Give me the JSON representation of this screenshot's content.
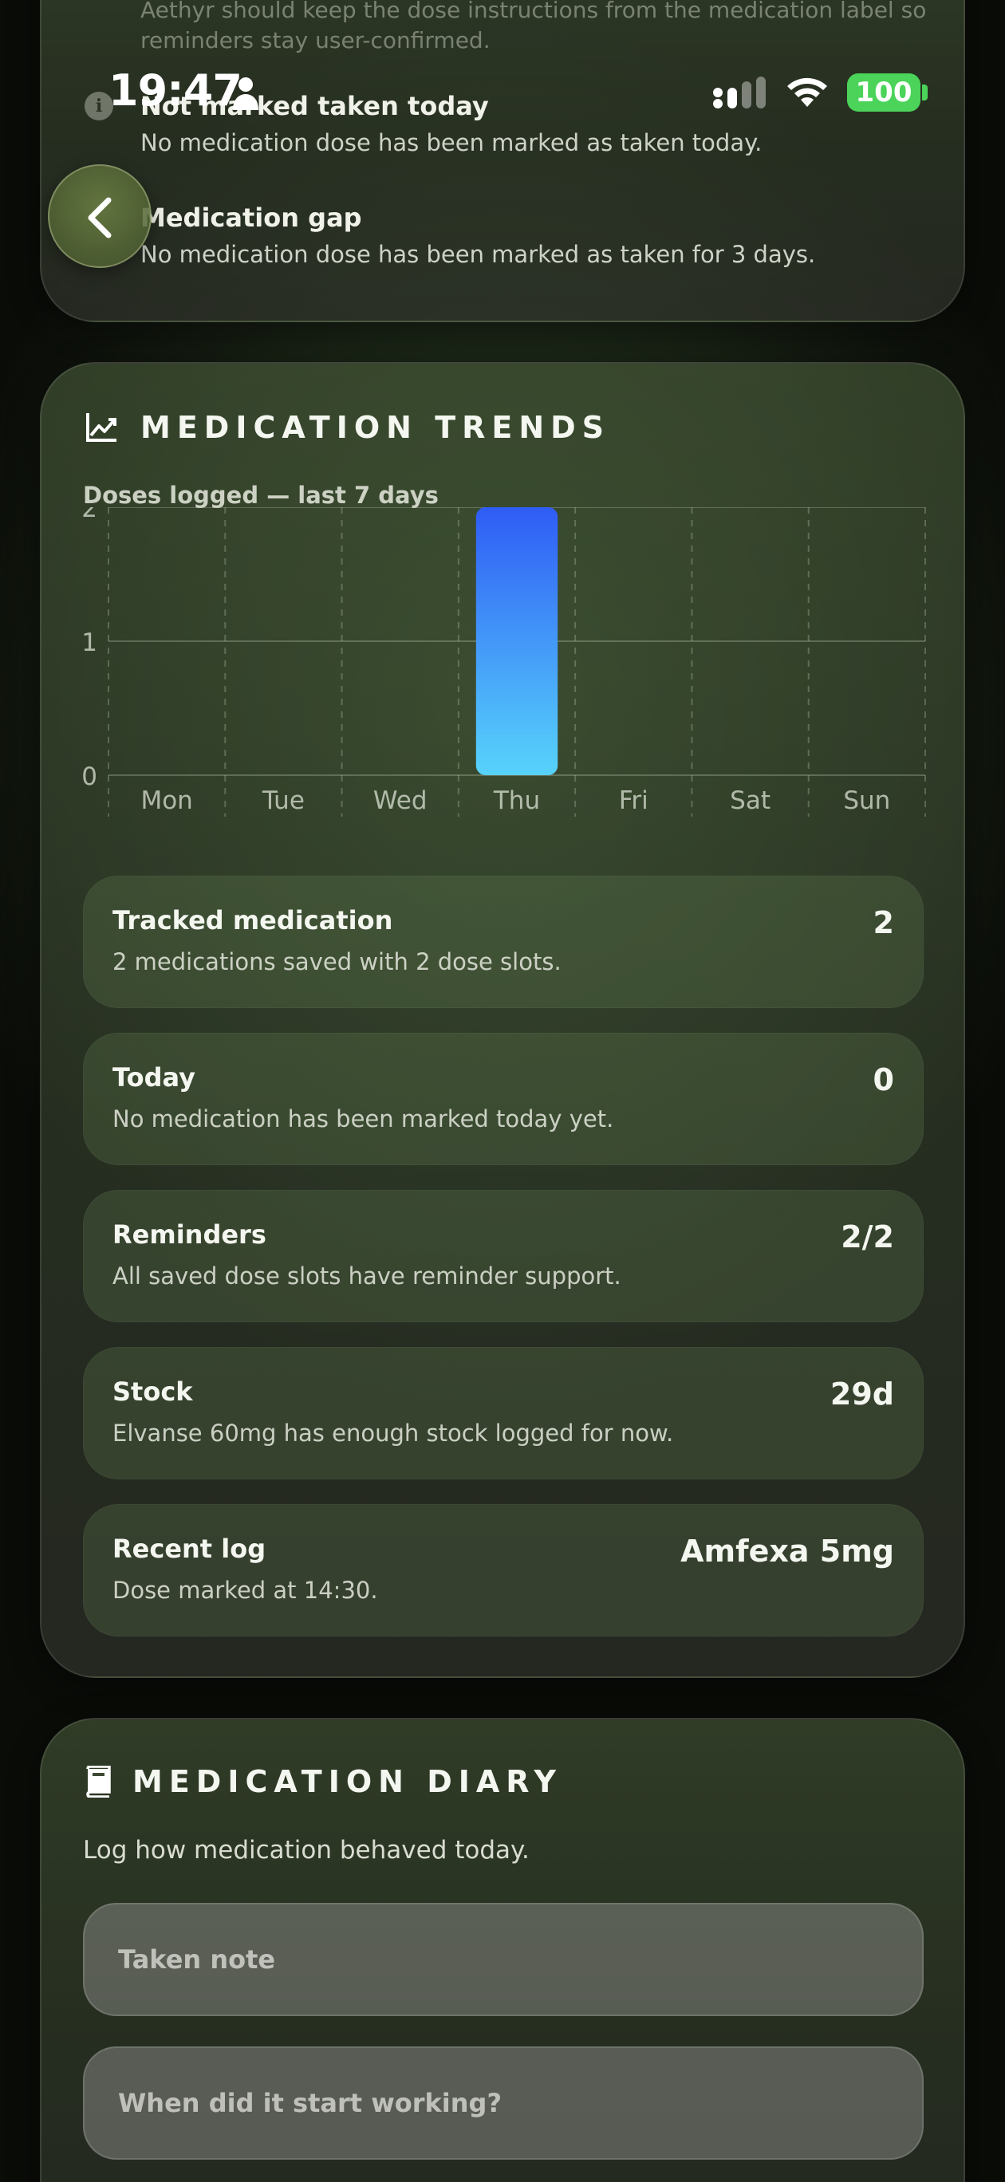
{
  "status_bar": {
    "time": "19:47",
    "battery": "100"
  },
  "top_card": {
    "faded_line_1": "Aethyr should keep the dose instructions from the medication label so",
    "faded_line_2": "reminders stay user-confirmed.",
    "alerts": [
      {
        "title": "Not marked taken today",
        "description": "No medication dose has been marked as taken today."
      },
      {
        "title": "Medication gap",
        "description": "No medication dose has been marked as taken for 3 days."
      }
    ]
  },
  "trends": {
    "title": "MEDICATION TRENDS",
    "chart_title": "Doses logged — last 7 days",
    "stats": [
      {
        "title": "Tracked medication",
        "description": "2 medications saved with 2 dose slots.",
        "value": "2"
      },
      {
        "title": "Today",
        "description": "No medication has been marked today yet.",
        "value": "0"
      },
      {
        "title": "Reminders",
        "description": "All saved dose slots have reminder support.",
        "value": "2/2"
      },
      {
        "title": "Stock",
        "description": "Elvanse 60mg has enough stock logged for now.",
        "value": "29d"
      },
      {
        "title": "Recent log",
        "description": "Dose marked at 14:30.",
        "value": "Amfexa 5mg"
      }
    ]
  },
  "chart_data": {
    "type": "bar",
    "title": "Doses logged — last 7 days",
    "categories": [
      "Mon",
      "Tue",
      "Wed",
      "Thu",
      "Fri",
      "Sat",
      "Sun"
    ],
    "values": [
      0,
      0,
      0,
      2,
      0,
      0,
      0
    ],
    "ylim": [
      0,
      2
    ],
    "yticks": [
      "0",
      "1",
      "2"
    ],
    "grid": true,
    "colors": {
      "bar_top": "#2f5cf5",
      "bar_bottom": "#57d3fb"
    }
  },
  "diary": {
    "title": "MEDICATION DIARY",
    "subtitle": "Log how medication behaved today.",
    "taken_note_placeholder": "Taken note",
    "start_working_placeholder": "When did it start working?"
  }
}
